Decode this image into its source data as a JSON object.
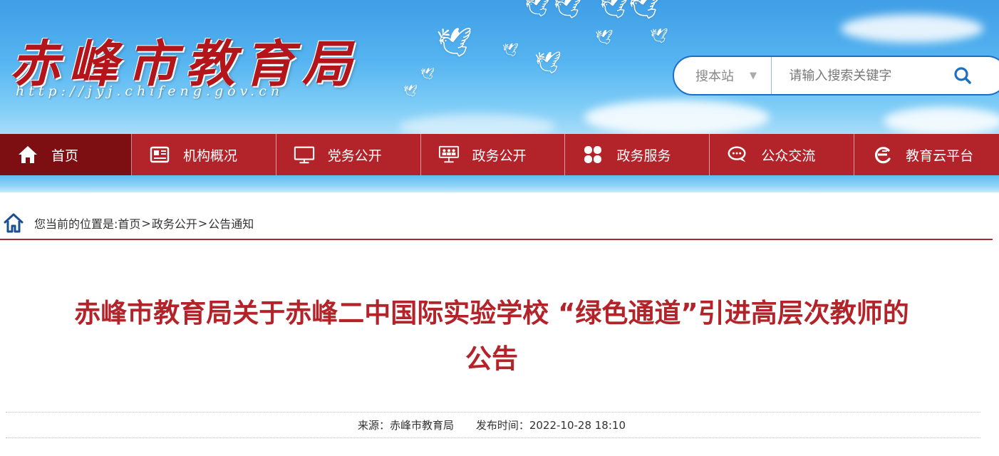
{
  "site": {
    "logo_text": "赤峰市教育局",
    "url_text": "http://jyj.chifeng.gov.cn"
  },
  "search": {
    "scope_label": "搜本站",
    "placeholder": "请输入搜索关键字"
  },
  "nav": {
    "items": [
      {
        "label": "首页",
        "icon": "home-icon"
      },
      {
        "label": "机构概况",
        "icon": "newspaper-icon"
      },
      {
        "label": "党务公开",
        "icon": "monitor-icon"
      },
      {
        "label": "政务公开",
        "icon": "meeting-icon"
      },
      {
        "label": "政务服务",
        "icon": "grid-icon"
      },
      {
        "label": "公众交流",
        "icon": "chat-icon"
      },
      {
        "label": "教育云平台",
        "icon": "cloud-e-icon"
      }
    ]
  },
  "breadcrumb": {
    "prefix": "您当前的位置是:",
    "items": [
      "首页",
      "政务公开",
      "公告通知"
    ],
    "separator": ">"
  },
  "article": {
    "title_line1": "赤峰市教育局关于赤峰二中国际实验学校 “绿色通道”引进高层次教师的",
    "title_line2": "公告",
    "source": "来源：赤峰市教育局",
    "published": "发布时间：2022-10-28 18:10"
  },
  "colors": {
    "brand_red": "#b3232a",
    "nav_active": "#7d0f13",
    "search_border": "#1e6fc4"
  }
}
